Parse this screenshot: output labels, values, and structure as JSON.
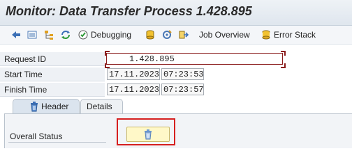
{
  "window": {
    "title": "Monitor: Data Transfer Process 1.428.895"
  },
  "toolbar": {
    "debugging_label": "Debugging",
    "job_overview_label": "Job Overview",
    "error_stack_label": "Error Stack"
  },
  "fields": {
    "request_id": {
      "label": "Request ID",
      "value": "1.428.895"
    },
    "start_time": {
      "label": "Start Time",
      "date": "17.11.2023",
      "time": "07:23:53"
    },
    "finish_time": {
      "label": "Finish Time",
      "date": "17.11.2023",
      "time": "07:23:57"
    }
  },
  "tabs": [
    {
      "label": "Header",
      "active": true
    },
    {
      "label": "Details",
      "active": false
    }
  ],
  "header_panel": {
    "overall_status_label": "Overall Status"
  },
  "colors": {
    "highlight": "#d61f1f",
    "status_button": "#fff8c8",
    "title_bar": "#e6ecf2"
  },
  "icons": [
    "back-arrow-icon",
    "list-icon",
    "hierarchy-icon",
    "refresh-icon",
    "debugging-icon",
    "database-icon",
    "settings-gear-icon",
    "export-icon",
    "job-overview-icon",
    "error-stack-icon",
    "trash-icon"
  ]
}
